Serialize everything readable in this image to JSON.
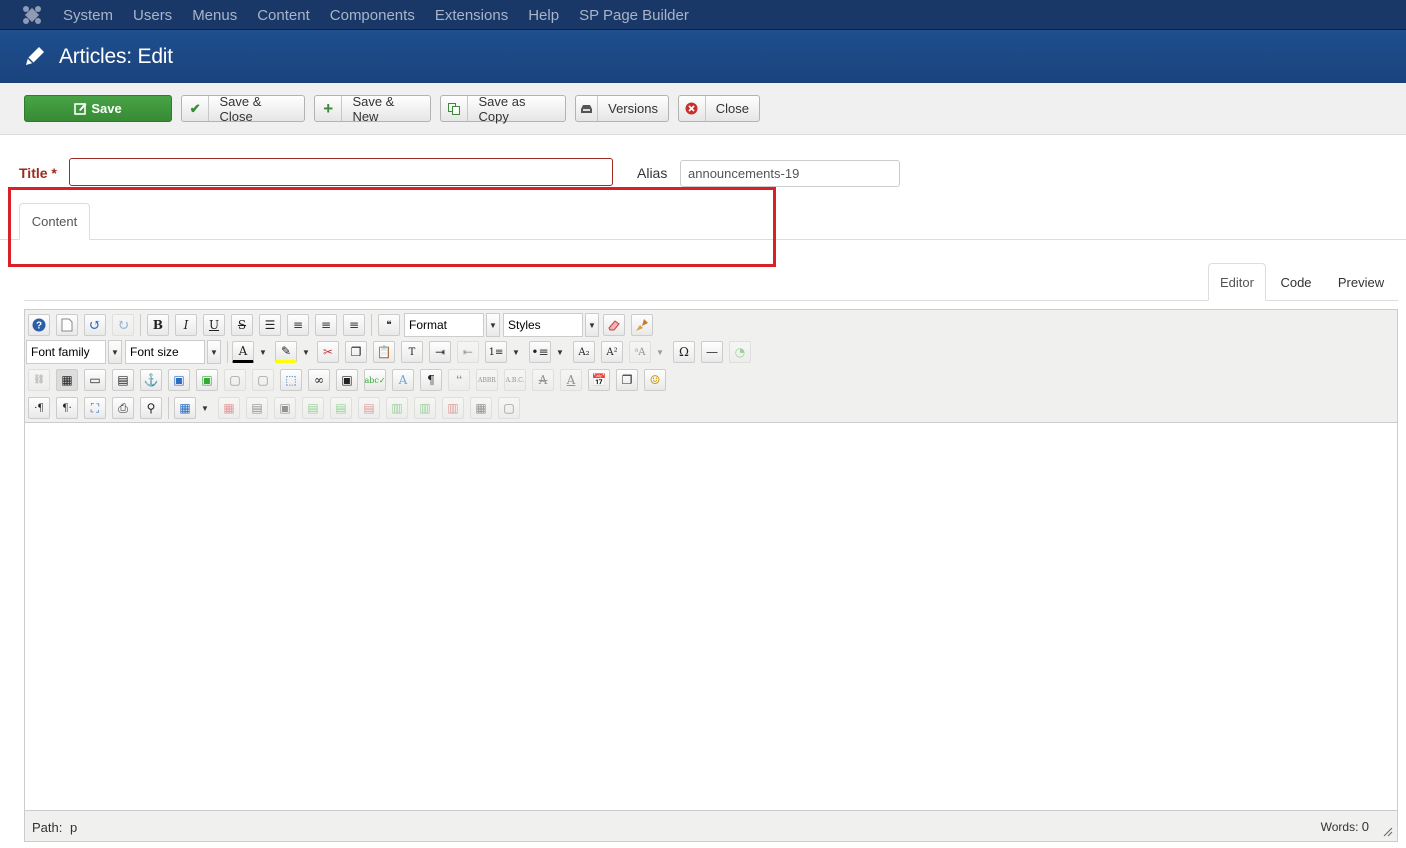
{
  "topnav": {
    "items": [
      "System",
      "Users",
      "Menus",
      "Content",
      "Components",
      "Extensions",
      "Help",
      "SP Page Builder"
    ]
  },
  "header": {
    "title": "Articles: Edit"
  },
  "toolbar": {
    "save": "Save",
    "save_close": "Save & Close",
    "save_new": "Save & New",
    "save_copy": "Save as Copy",
    "versions": "Versions",
    "close": "Close"
  },
  "form": {
    "title_label": "Title *",
    "title_value": "",
    "alias_label": "Alias",
    "alias_value": "announcements-19"
  },
  "tabs": {
    "content": "Content"
  },
  "editor_tabs": {
    "editor": "Editor",
    "code": "Code",
    "preview": "Preview"
  },
  "editor_toolbar": {
    "format": "Format",
    "styles": "Styles",
    "font_family": "Font family",
    "font_size": "Font size"
  },
  "statusbar": {
    "path_label": "Path:",
    "path_value": "p",
    "words_label": "Words:",
    "words_value": "0"
  },
  "colors": {
    "navbar": "#1a3867",
    "header": "#1e4c8a",
    "save_green": "#3f9a3d",
    "highlight_red": "#d92029",
    "required_red": "#9a2a1b"
  }
}
